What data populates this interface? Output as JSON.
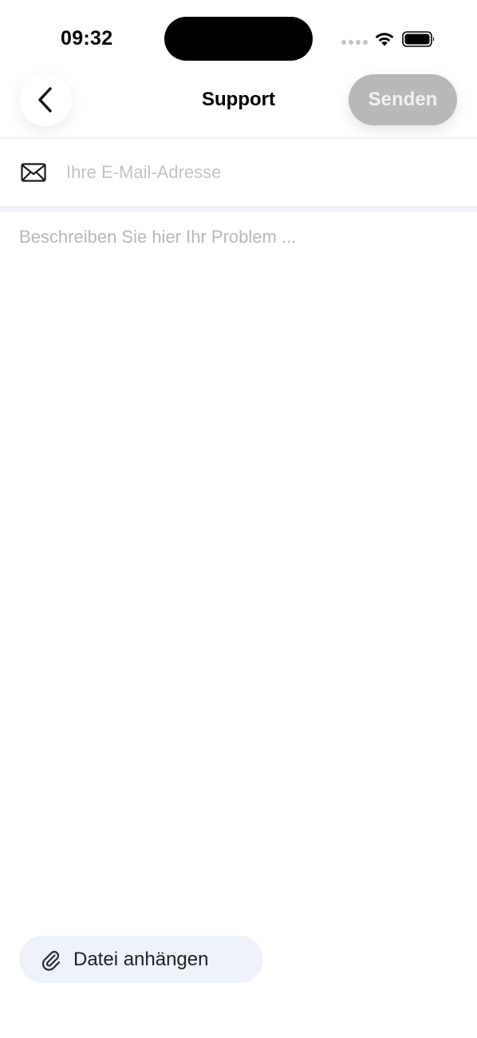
{
  "status_bar": {
    "time": "09:32"
  },
  "nav": {
    "title": "Support",
    "send_label": "Senden",
    "back_icon": "chevron-left-icon"
  },
  "email": {
    "icon": "mail-icon",
    "placeholder": "Ihre E-Mail-Adresse",
    "value": ""
  },
  "description": {
    "placeholder": "Beschreiben Sie hier Ihr Problem ...",
    "value": ""
  },
  "attach": {
    "icon": "paperclip-icon",
    "label": "Datei anhängen"
  },
  "colors": {
    "send_disabled_bg": "#b8b8b8",
    "attach_bg": "#eef2fa",
    "divider": "#eef2fa"
  }
}
